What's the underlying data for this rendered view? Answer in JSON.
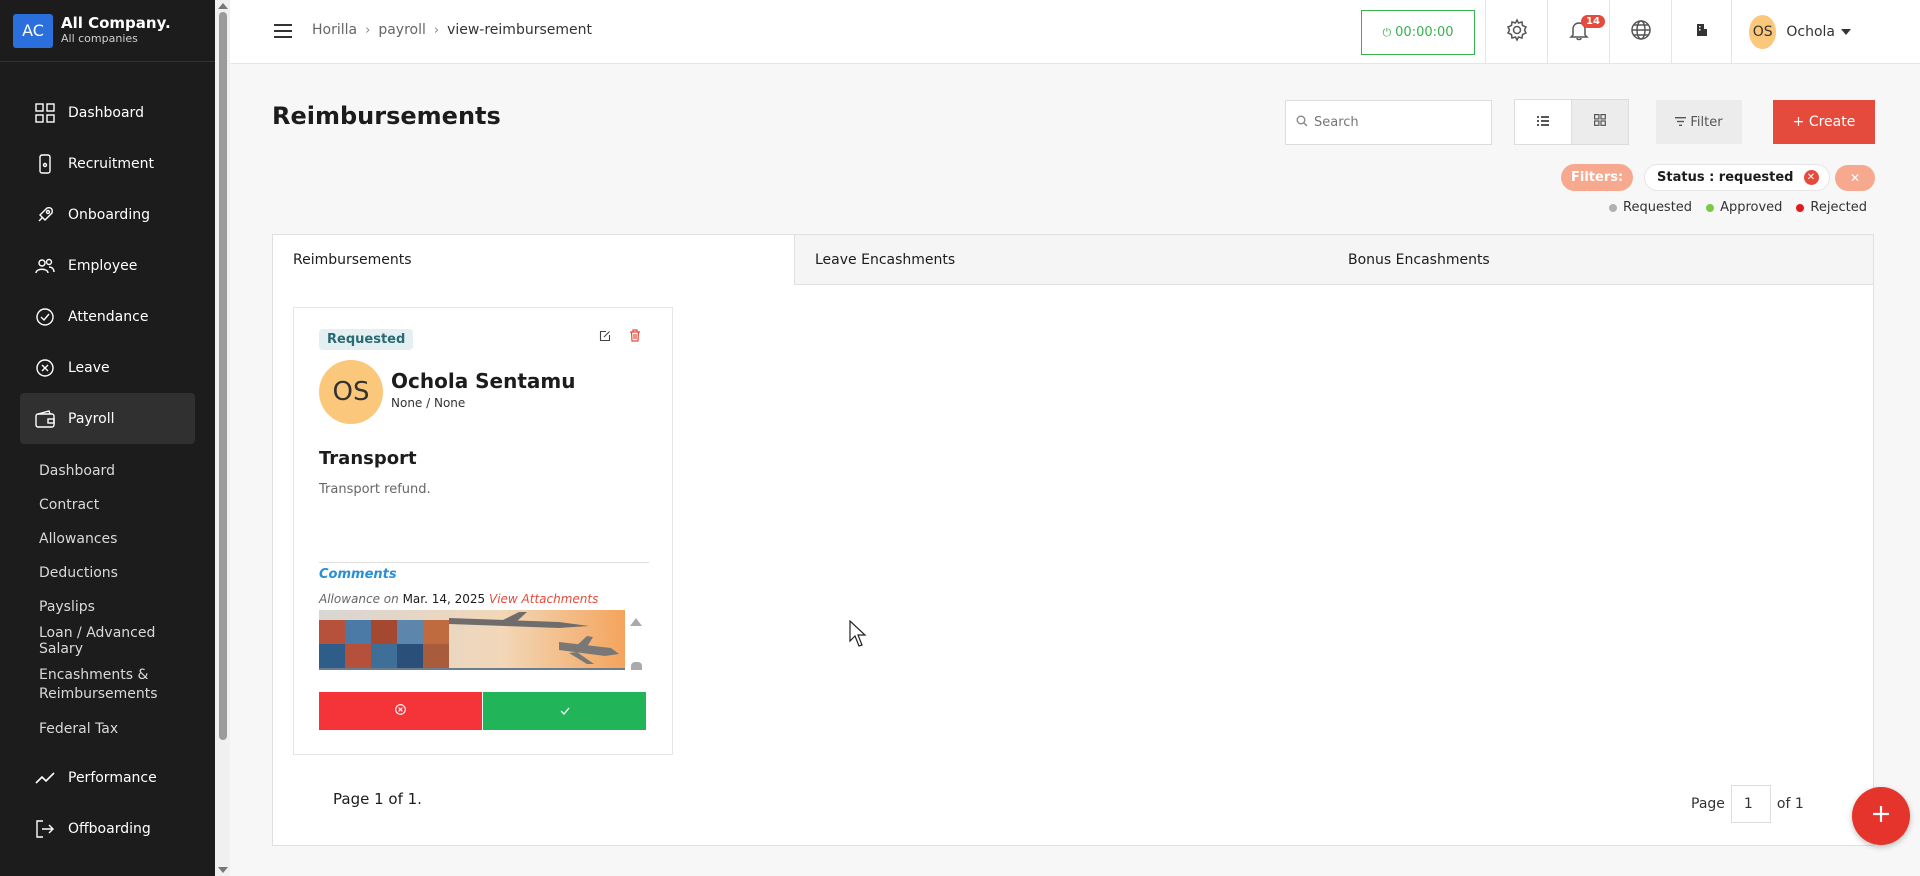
{
  "company": {
    "initials": "AC",
    "name": "All Company.",
    "subtitle": "All companies"
  },
  "sidebar": {
    "items": [
      {
        "label": "Dashboard",
        "icon": "grid-icon"
      },
      {
        "label": "Recruitment",
        "icon": "phone-icon"
      },
      {
        "label": "Onboarding",
        "icon": "rocket-icon"
      },
      {
        "label": "Employee",
        "icon": "users-icon"
      },
      {
        "label": "Attendance",
        "icon": "check-circle-icon"
      },
      {
        "label": "Leave",
        "icon": "x-circle-icon"
      },
      {
        "label": "Payroll",
        "icon": "wallet-icon"
      }
    ],
    "payroll_sub": [
      "Dashboard",
      "Contract",
      "Allowances",
      "Deductions",
      "Payslips",
      "Loan / Advanced Salary",
      "Encashments & Reimbursements",
      "Federal Tax"
    ],
    "items_after": [
      {
        "label": "Performance",
        "icon": "trend-icon"
      },
      {
        "label": "Offboarding",
        "icon": "exit-icon"
      }
    ]
  },
  "header": {
    "breadcrumb": [
      "Horilla",
      "payroll",
      "view-reimbursement"
    ],
    "timer": "00:00:00",
    "notification_count": "14",
    "user_initials": "OS",
    "user_name": "Ochola"
  },
  "page": {
    "title": "Reimbursements",
    "search_placeholder": "Search",
    "filter_label": "Filter",
    "create_label": "+ Create",
    "filters_label": "Filters:",
    "filter_chip": "Status : requested",
    "legend": [
      {
        "label": "Requested",
        "color": "#b0b0b0"
      },
      {
        "label": "Approved",
        "color": "#7ac943"
      },
      {
        "label": "Rejected",
        "color": "#e31b1b"
      }
    ]
  },
  "tabs": [
    "Reimbursements",
    "Leave Encashments",
    "Bonus Encashments"
  ],
  "card": {
    "status": "Requested",
    "employee_initials": "OS",
    "employee_name": "Ochola Sentamu",
    "employee_sub": "None / None",
    "title": "Transport",
    "description": "Transport refund.",
    "comments_label": "Comments",
    "allowance_prefix": "Allowance on",
    "date": "Mar. 14, 2025",
    "attachments_label": "View Attachments"
  },
  "pagination": {
    "info": "Page 1 of 1.",
    "page_label": "Page",
    "current": "1",
    "of_label": "of 1"
  }
}
